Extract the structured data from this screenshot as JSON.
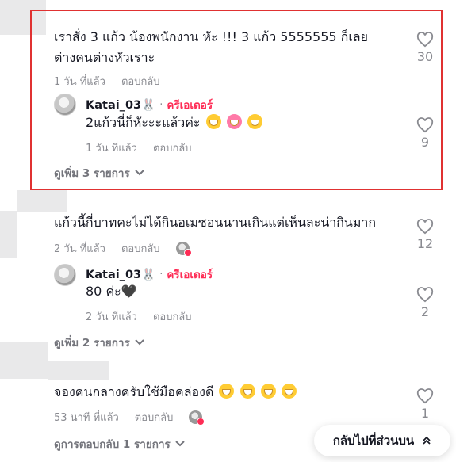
{
  "thread1": {
    "comment": {
      "text_line1": "เราสั่ง 3 แก้ว น้องพนักงาน หัะ !!! 3 แก้ว 5555555 ก็เลย",
      "text_line2": "ต่างคนต่างหัวเราะ",
      "time": "1 วัน ที่แล้ว",
      "reply_label": "ตอบกลับ",
      "likes": "30"
    },
    "reply": {
      "username": "Katai_03🐰",
      "separator": "·",
      "badge": "ครีเอเตอร์",
      "text": "2แก้วนี่ก็หัะะะแล้วค่ะ",
      "time": "1 วัน ที่แล้ว",
      "reply_label": "ตอบกลับ",
      "likes": "9"
    },
    "more": "ดูเพิ่ม 3 รายการ"
  },
  "thread2": {
    "comment": {
      "text": "แก้วนี้กี่บาทคะไม่ได้กินอเมซอนนานเกินแต่เห็นละน่ากินมาก",
      "time": "2 วัน ที่แล้ว",
      "reply_label": "ตอบกลับ",
      "likes": "12"
    },
    "reply": {
      "username": "Katai_03🐰",
      "separator": "·",
      "badge": "ครีเอเตอร์",
      "text": "80 ค่ะ🖤",
      "time": "2 วัน ที่แล้ว",
      "reply_label": "ตอบกลับ",
      "likes": "2"
    },
    "more": "ดูเพิ่ม 2 รายการ"
  },
  "thread3": {
    "comment": {
      "text": "จองคนกลางครับใช้มือคล่องดี",
      "time": "53 นาที ที่แล้ว",
      "reply_label": "ตอบกลับ",
      "likes": "1"
    },
    "more": "ดูการตอบกลับ 1 รายการ"
  },
  "back_to_top": "กลับไปที่ส่วนบน",
  "icons": {
    "like": "heart-outline-icon",
    "expand": "chevron-down-icon",
    "back": "double-chevron-up-icon",
    "emoji": "laughing-emoji-icon"
  },
  "colors": {
    "highlight_border": "#e03131",
    "creator_badge": "#fe2c55",
    "meta_text": "#8a8b91"
  }
}
